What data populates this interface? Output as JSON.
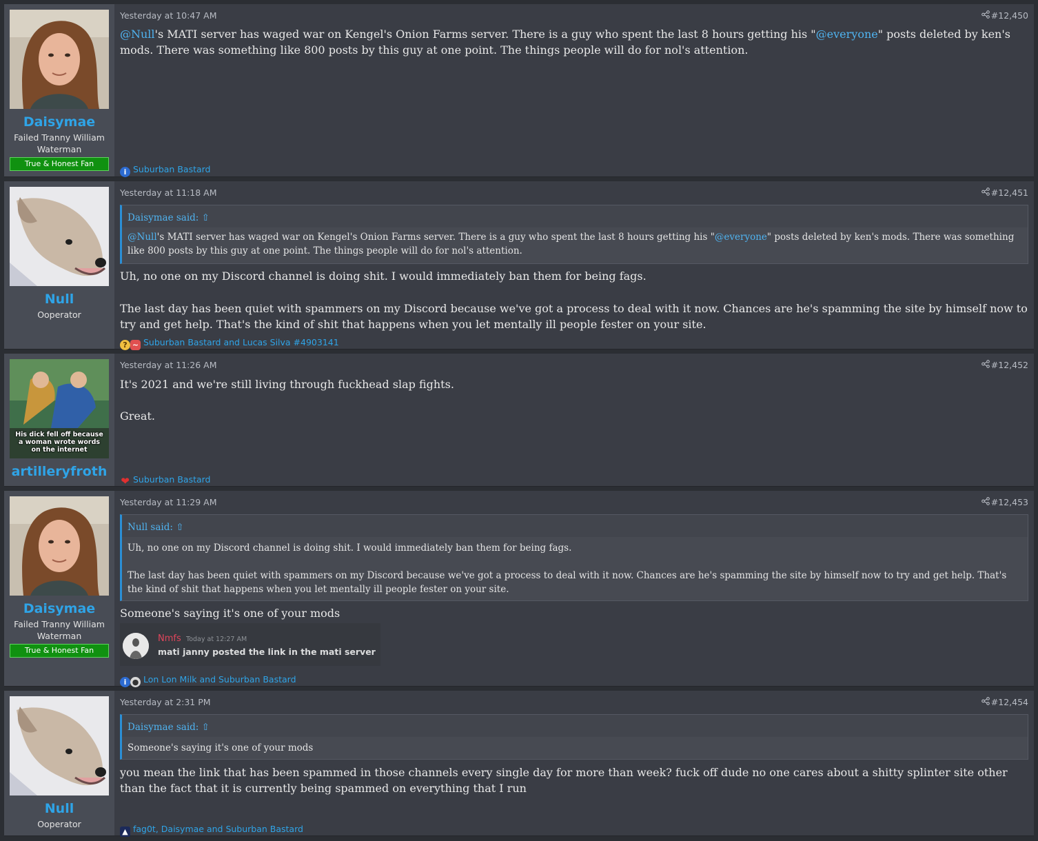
{
  "posts": [
    {
      "author": "Daisymae",
      "user_title": "Failed Tranny William Waterman",
      "banner": "True & Honest Fan",
      "date": "Yesterday at 10:47 AM",
      "number": "#12,450",
      "body": {
        "mention": "@Null",
        "text1": "'s MATI server has waged war on Kengel's Onion Farms server. There is a guy who spent the last 8 hours getting his \"",
        "mention2": "@everyone",
        "text2": "\" posts deleted by ken's mods. There was something like 800 posts by this guy at one point. The things people will do for nol's attention."
      },
      "reactions": "Suburban Bastard"
    },
    {
      "author": "Null",
      "user_title": "Ooperator",
      "date": "Yesterday at 11:18 AM",
      "number": "#12,451",
      "quote": {
        "header": "Daisymae said:",
        "mention": "@Null",
        "text1": "'s MATI server has waged war on Kengel's Onion Farms server. There is a guy who spent the last 8 hours getting his \"",
        "mention2": "@everyone",
        "text2": "\" posts deleted by ken's mods. There was something like 800 posts by this guy at one point. The things people will do for nol's attention."
      },
      "body": {
        "p1": "Uh, no one on my Discord channel is doing shit. I would immediately ban them for being fags.",
        "p2": "The last day has been quiet with spammers on my Discord because we've got a process to deal with it now. Chances are he's spamming the site by himself now to try and get help. That's the kind of shit that happens when you let mentally ill people fester on your site."
      },
      "reactions": "Suburban Bastard and Lucas Silva #4903141"
    },
    {
      "author": "artilleryfroth",
      "avatar_caption": "His dick fell off because a woman wrote words on the internet",
      "date": "Yesterday at 11:26 AM",
      "number": "#12,452",
      "body": {
        "p1": "It's 2021 and we're still living through fuckhead slap fights.",
        "p2": "Great."
      },
      "reactions": "Suburban Bastard"
    },
    {
      "author": "Daisymae",
      "user_title": "Failed Tranny William Waterman",
      "banner": "True & Honest Fan",
      "date": "Yesterday at 11:29 AM",
      "number": "#12,453",
      "quote": {
        "header": "Null said:",
        "p1": "Uh, no one on my Discord channel is doing shit. I would immediately ban them for being fags.",
        "p2": "The last day has been quiet with spammers on my Discord because we've got a process to deal with it now. Chances are he's spamming the site by himself now to try and get help. That's the kind of shit that happens when you let mentally ill people fester on your site."
      },
      "body": {
        "p1": "Someone's saying it's one of your mods"
      },
      "embed": {
        "name": "Nmfs",
        "time": "Today at 12:27 AM",
        "text": "mati janny posted the link in the mati server"
      },
      "reactions": "Lon Lon Milk and Suburban Bastard"
    },
    {
      "author": "Null",
      "user_title": "Ooperator",
      "date": "Yesterday at 2:31 PM",
      "number": "#12,454",
      "quote": {
        "header": "Daisymae said:",
        "p1": "Someone's saying it's one of your mods"
      },
      "body": {
        "p1": "you mean the link that has been spammed in those channels every single day for more than week? fuck off dude no one cares about a shitty splinter site other than the fact that it is currently being spammed on everything that I run"
      },
      "reactions": "fag0t, Daisymae and Suburban Bastard"
    }
  ],
  "colors": {
    "link": "#2fa4e7",
    "banner_green": "#109110",
    "post_bg": "#3a3d45",
    "sidebar_bg": "#484c55"
  },
  "icons": {
    "share": "share-icon",
    "quote_up": "arrow-up-circle-icon",
    "informative": "info-icon",
    "heart": "heart-icon"
  }
}
